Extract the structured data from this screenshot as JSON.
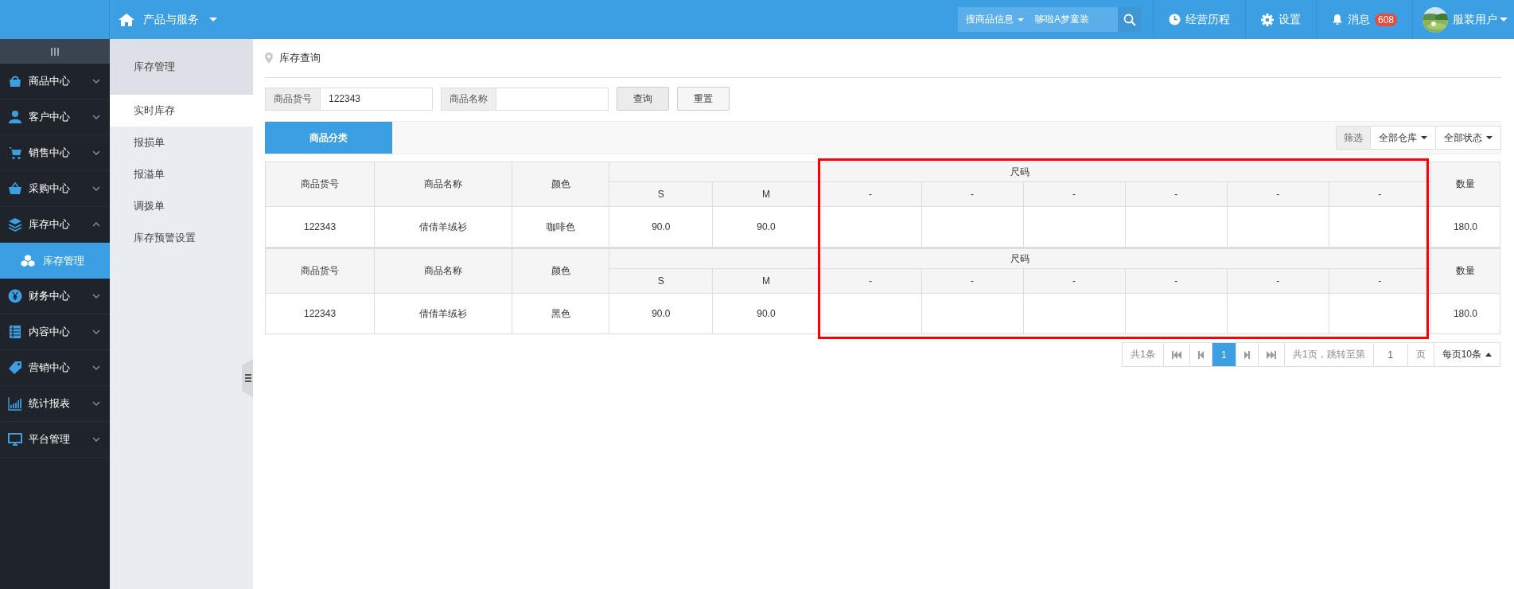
{
  "topbar": {
    "home_menu": "产品与服务",
    "search": {
      "scope": "搜商品信息",
      "value": "哆啦A梦童装"
    },
    "links": [
      {
        "kind": "history",
        "label": "经营历程"
      },
      {
        "kind": "settings",
        "label": "设置"
      },
      {
        "kind": "messages",
        "label": "消息",
        "badge": "608"
      }
    ],
    "user": {
      "name": "服装用户"
    }
  },
  "sidebar": {
    "items": [
      {
        "kind": "bag",
        "label": "商品中心",
        "expanded": false
      },
      {
        "kind": "person",
        "label": "客户中心",
        "expanded": false
      },
      {
        "kind": "cart",
        "label": "销售中心",
        "expanded": false
      },
      {
        "kind": "basket",
        "label": "采购中心",
        "expanded": false
      },
      {
        "kind": "layers",
        "label": "库存中心",
        "expanded": true,
        "children": [
          {
            "label": "库存管理",
            "selected": true
          }
        ]
      },
      {
        "kind": "yen",
        "label": "财务中心",
        "expanded": false
      },
      {
        "kind": "list",
        "label": "内容中心",
        "expanded": false
      },
      {
        "kind": "tag",
        "label": "营销中心",
        "expanded": false
      },
      {
        "kind": "chart",
        "label": "统计报表",
        "expanded": false
      },
      {
        "kind": "monitor",
        "label": "平台管理",
        "expanded": false
      }
    ]
  },
  "submenu": {
    "title": "库存管理",
    "items": [
      {
        "label": "实时库存",
        "selected": true
      },
      {
        "label": "报损单",
        "selected": false
      },
      {
        "label": "报溢单",
        "selected": false
      },
      {
        "label": "调拨单",
        "selected": false
      },
      {
        "label": "库存预警设置",
        "selected": false
      }
    ]
  },
  "breadcrumb": "库存查询",
  "filters": [
    {
      "label": "商品货号",
      "value": "122343"
    },
    {
      "label": "商品名称"
    }
  ],
  "buttons": [
    "查询",
    "重置"
  ],
  "tabs": [
    {
      "label": "商品分类",
      "selected": true
    }
  ],
  "toolbar": {
    "label": "筛选",
    "dropdowns": [
      "全部仓库",
      "全部状态"
    ]
  },
  "table": {
    "blocks": [
      {
        "columns": [
          "商品货号",
          "商品名称",
          "颜色"
        ],
        "size_group": "尺码",
        "sizes": [
          "S",
          "M",
          "-",
          "-",
          "-",
          "-",
          "-",
          "-"
        ],
        "total_column": "数量",
        "cells": [
          "122343",
          "倩倩羊绒衫",
          "咖啡色"
        ],
        "size_values": [
          "90.0",
          "90.0"
        ],
        "total": "180.0"
      },
      {
        "columns": [
          "商品货号",
          "商品名称",
          "颜色"
        ],
        "size_group": "尺码",
        "sizes": [
          "S",
          "M",
          "-",
          "-",
          "-",
          "-",
          "-",
          "-"
        ],
        "total_column": "数量",
        "cells": [
          "122343",
          "倩倩羊绒衫",
          "黑色"
        ],
        "size_values": [
          "90.0",
          "90.0"
        ],
        "total": "180.0"
      }
    ]
  },
  "highlight": {
    "kind": "frame"
  },
  "pagination": {
    "total": "共1条",
    "pages": [
      {
        "label": "1",
        "selected": true
      }
    ],
    "jump_label": "共1页，跳转至第",
    "page_input": "1",
    "page_unit": "页",
    "page_size": "每页10条"
  }
}
